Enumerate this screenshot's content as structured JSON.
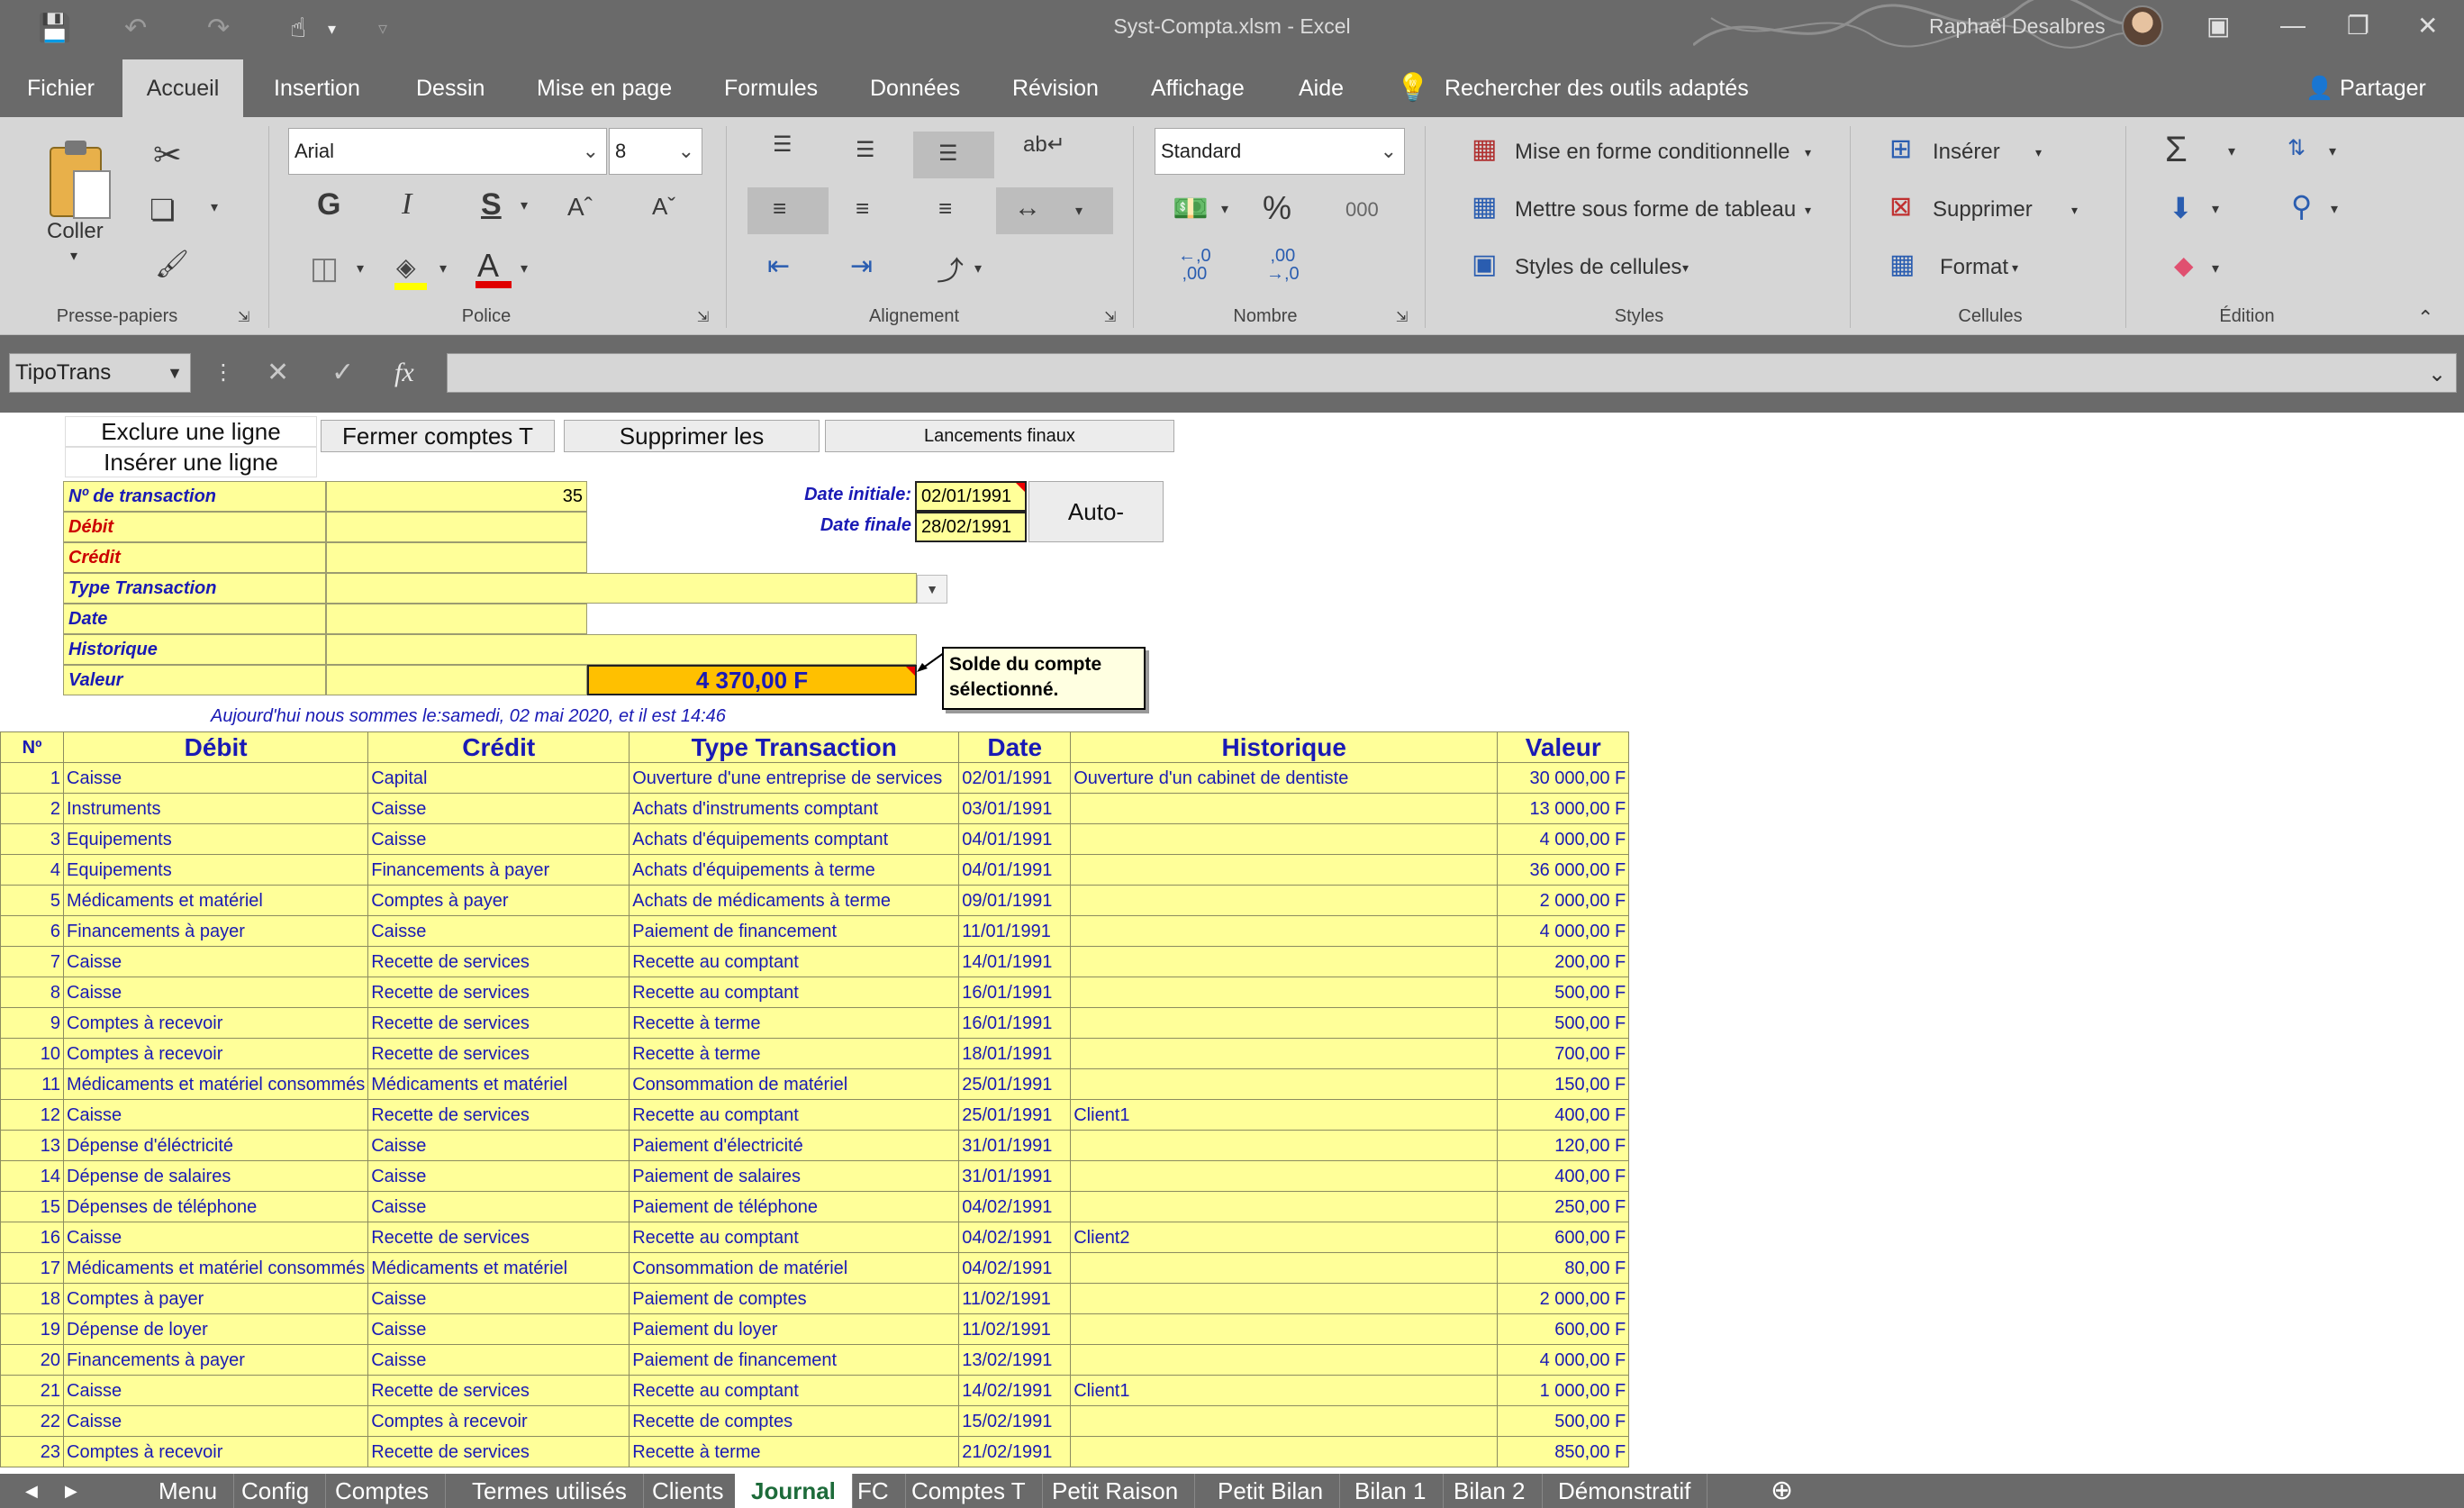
{
  "window": {
    "title": "Syst-Compta.xlsm  -  Excel",
    "user": "Raphaël Desalbres"
  },
  "menu": {
    "tabs": [
      "Fichier",
      "Accueil",
      "Insertion",
      "Dessin",
      "Mise en page",
      "Formules",
      "Données",
      "Révision",
      "Affichage",
      "Aide"
    ],
    "search": "Rechercher des outils adaptés",
    "share": "Partager"
  },
  "ribbon": {
    "paste": "Coller",
    "font_name": "Arial",
    "font_size": "8",
    "number_format": "Standard",
    "conditional_format": "Mise en forme conditionnelle",
    "format_table": "Mettre sous forme de tableau",
    "cell_styles": "Styles de cellules",
    "insert": "Insérer",
    "delete": "Supprimer",
    "format": "Format",
    "groups": [
      "Presse-papiers",
      "Police",
      "Alignement",
      "Nombre",
      "Styles",
      "Cellules",
      "Édition"
    ]
  },
  "formula_bar": {
    "name_box": "TipoTrans",
    "value": ""
  },
  "buttons": {
    "exclude_line": "Exclure une ligne",
    "insert_line": "Insérer une ligne",
    "close_accounts": "Fermer comptes T",
    "delete_them": "Supprimer les",
    "final_launch": "Lancements finaux",
    "auto": "Auto-"
  },
  "form": {
    "transaction_no_label": "Nº de transaction",
    "transaction_no": "35",
    "debit_label": "Débit",
    "credit_label": "Crédit",
    "type_label": "Type Transaction",
    "date_label": "Date",
    "history_label": "Historique",
    "value_label": "Valeur",
    "balance": "4 370,00 F",
    "balance_note": "Solde du compte sélectionné.",
    "start_date_label": "Date initiale:",
    "start_date": "02/01/1991",
    "end_date_label": "Date finale",
    "end_date": "28/02/1991",
    "today_text": "Aujourd'hui nous sommes le:samedi, 02 mai 2020, et il est 14:46"
  },
  "journal": {
    "headers": [
      "Nº",
      "Débit",
      "Crédit",
      "Type Transaction",
      "Date",
      "Historique",
      "Valeur"
    ],
    "rows": [
      [
        "1",
        "Caisse",
        "Capital",
        "Ouverture d'une entreprise de services",
        "02/01/1991",
        "Ouverture d'un cabinet de dentiste",
        "30 000,00 F"
      ],
      [
        "2",
        "Instruments",
        "Caisse",
        "Achats d'instruments comptant",
        "03/01/1991",
        "",
        "13 000,00 F"
      ],
      [
        "3",
        "Equipements",
        "Caisse",
        "Achats d'équipements comptant",
        "04/01/1991",
        "",
        "4 000,00 F"
      ],
      [
        "4",
        "Equipements",
        "Financements à payer",
        "Achats d'équipements à terme",
        "04/01/1991",
        "",
        "36 000,00 F"
      ],
      [
        "5",
        "Médicaments et matériel",
        "Comptes à payer",
        "Achats de médicaments à terme",
        "09/01/1991",
        "",
        "2 000,00 F"
      ],
      [
        "6",
        "Financements à payer",
        "Caisse",
        "Paiement de financement",
        "11/01/1991",
        "",
        "4 000,00 F"
      ],
      [
        "7",
        "Caisse",
        "Recette de services",
        "Recette au comptant",
        "14/01/1991",
        "",
        "200,00 F"
      ],
      [
        "8",
        "Caisse",
        "Recette de services",
        "Recette au comptant",
        "16/01/1991",
        "",
        "500,00 F"
      ],
      [
        "9",
        "Comptes à recevoir",
        "Recette de services",
        "Recette à terme",
        "16/01/1991",
        "",
        "500,00 F"
      ],
      [
        "10",
        "Comptes à recevoir",
        "Recette de services",
        "Recette à terme",
        "18/01/1991",
        "",
        "700,00 F"
      ],
      [
        "11",
        "Médicaments et matériel consommés",
        "Médicaments et matériel",
        "Consommation de matériel",
        "25/01/1991",
        "",
        "150,00 F"
      ],
      [
        "12",
        "Caisse",
        "Recette de services",
        "Recette au comptant",
        "25/01/1991",
        "Client1",
        "400,00 F"
      ],
      [
        "13",
        "Dépense d'éléctricité",
        "Caisse",
        "Paiement d'électricité",
        "31/01/1991",
        "",
        "120,00 F"
      ],
      [
        "14",
        "Dépense de salaires",
        "Caisse",
        "Paiement de salaires",
        "31/01/1991",
        "",
        "400,00 F"
      ],
      [
        "15",
        "Dépenses de téléphone",
        "Caisse",
        "Paiement de téléphone",
        "04/02/1991",
        "",
        "250,00 F"
      ],
      [
        "16",
        "Caisse",
        "Recette de services",
        "Recette au comptant",
        "04/02/1991",
        "Client2",
        "600,00 F"
      ],
      [
        "17",
        "Médicaments et matériel consommés",
        "Médicaments et matériel",
        "Consommation de matériel",
        "04/02/1991",
        "",
        "80,00 F"
      ],
      [
        "18",
        "Comptes à payer",
        "Caisse",
        "Paiement de comptes",
        "11/02/1991",
        "",
        "2 000,00 F"
      ],
      [
        "19",
        "Dépense de loyer",
        "Caisse",
        "Paiement du loyer",
        "11/02/1991",
        "",
        "600,00 F"
      ],
      [
        "20",
        "Financements à payer",
        "Caisse",
        "Paiement de financement",
        "13/02/1991",
        "",
        "4 000,00 F"
      ],
      [
        "21",
        "Caisse",
        "Recette de services",
        "Recette au comptant",
        "14/02/1991",
        "Client1",
        "1 000,00 F"
      ],
      [
        "22",
        "Caisse",
        "Comptes à recevoir",
        "Recette de comptes",
        "15/02/1991",
        "",
        "500,00 F"
      ],
      [
        "23",
        "Comptes à recevoir",
        "Recette de services",
        "Recette à terme",
        "21/02/1991",
        "",
        "850,00 F"
      ]
    ]
  },
  "sheet_tabs": [
    "Menu",
    "Config",
    "Comptes",
    "Termes utilisés",
    "Clients",
    "Journal",
    "FC",
    "Comptes T",
    "Petit Raison",
    "Petit Bilan",
    "Bilan 1",
    "Bilan 2",
    "Démonstratif"
  ],
  "active_sheet": "Journal",
  "colors": {
    "cell_yellow": "#ffff99",
    "highlight_orange": "#ffc000",
    "label_blue": "#1a1ab5",
    "label_red": "#cc0000",
    "ribbon_gray": "#d6d6d6",
    "chrome_gray": "#6a6a6a"
  }
}
